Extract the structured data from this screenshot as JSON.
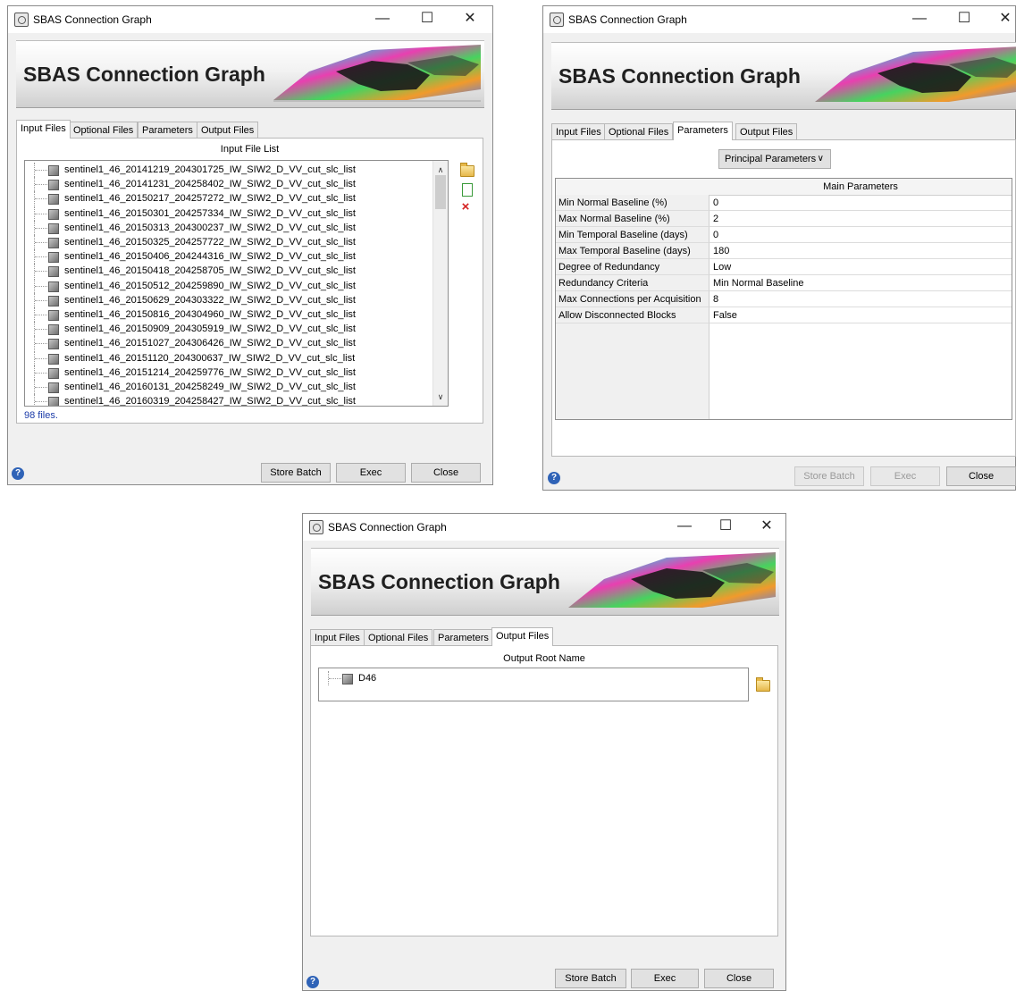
{
  "window_title": "SBAS Connection Graph",
  "banner_title": "SBAS Connection Graph",
  "controls": {
    "minimize": "—",
    "maximize": "☐",
    "close": "✕"
  },
  "tabs": [
    "Input Files",
    "Optional Files",
    "Parameters",
    "Output Files"
  ],
  "buttons": {
    "store_batch": "Store Batch",
    "exec": "Exec",
    "close": "Close"
  },
  "help_glyph": "?",
  "input_panel": {
    "header": "Input File List",
    "files": [
      "sentinel1_46_20141219_204301725_IW_SIW2_D_VV_cut_slc_list",
      "sentinel1_46_20141231_204258402_IW_SIW2_D_VV_cut_slc_list",
      "sentinel1_46_20150217_204257272_IW_SIW2_D_VV_cut_slc_list",
      "sentinel1_46_20150301_204257334_IW_SIW2_D_VV_cut_slc_list",
      "sentinel1_46_20150313_204300237_IW_SIW2_D_VV_cut_slc_list",
      "sentinel1_46_20150325_204257722_IW_SIW2_D_VV_cut_slc_list",
      "sentinel1_46_20150406_204244316_IW_SIW2_D_VV_cut_slc_list",
      "sentinel1_46_20150418_204258705_IW_SIW2_D_VV_cut_slc_list",
      "sentinel1_46_20150512_204259890_IW_SIW2_D_VV_cut_slc_list",
      "sentinel1_46_20150629_204303322_IW_SIW2_D_VV_cut_slc_list",
      "sentinel1_46_20150816_204304960_IW_SIW2_D_VV_cut_slc_list",
      "sentinel1_46_20150909_204305919_IW_SIW2_D_VV_cut_slc_list",
      "sentinel1_46_20151027_204306426_IW_SIW2_D_VV_cut_slc_list",
      "sentinel1_46_20151120_204300637_IW_SIW2_D_VV_cut_slc_list",
      "sentinel1_46_20151214_204259776_IW_SIW2_D_VV_cut_slc_list",
      "sentinel1_46_20160131_204258249_IW_SIW2_D_VV_cut_slc_list",
      "sentinel1_46_20160319_204258427_IW_SIW2_D_VV_cut_slc_list"
    ],
    "count_label": "98 files.",
    "scroll_up": "∧",
    "scroll_down": "∨"
  },
  "params_panel": {
    "dropdown": "Principal Parameters",
    "header": "Main Parameters",
    "rows": [
      {
        "name": "Min Normal Baseline (%)",
        "value": "0"
      },
      {
        "name": "Max Normal Baseline (%)",
        "value": "2"
      },
      {
        "name": "Min Temporal Baseline (days)",
        "value": "0"
      },
      {
        "name": "Max Temporal Baseline (days)",
        "value": "180"
      },
      {
        "name": "Degree of Redundancy",
        "value": "Low"
      },
      {
        "name": "Redundancy Criteria",
        "value": "Min Normal Baseline"
      },
      {
        "name": "Max Connections per Acquisition",
        "value": "8"
      },
      {
        "name": "Allow Disconnected Blocks",
        "value": "False"
      }
    ]
  },
  "output_panel": {
    "header": "Output Root Name",
    "item": "D46"
  }
}
